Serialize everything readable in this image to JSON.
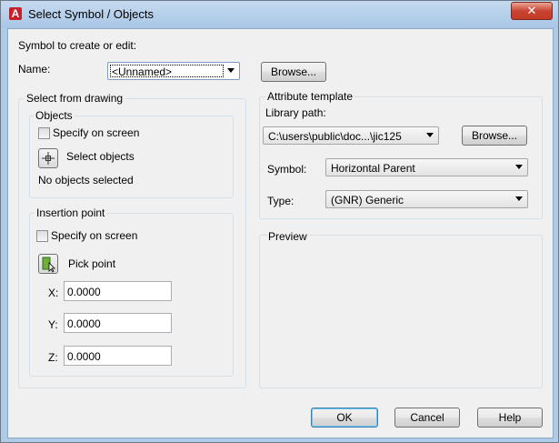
{
  "window": {
    "title": "Select Symbol / Objects",
    "app_icon": "A",
    "close_glyph": "✕"
  },
  "symbol_section": {
    "heading": "Symbol to create or edit:",
    "name_label": "Name:",
    "name_value": "<Unnamed>",
    "browse_label": "Browse..."
  },
  "select_from_drawing": {
    "title": "Select from drawing",
    "objects": {
      "title": "Objects",
      "specify_on_screen": "Specify on screen",
      "select_objects": "Select objects",
      "status": "No objects selected"
    },
    "insertion_point": {
      "title": "Insertion point",
      "specify_on_screen": "Specify on screen",
      "pick_point": "Pick point",
      "x_label": "X:",
      "x_value": "0.0000",
      "y_label": "Y:",
      "y_value": "0.0000",
      "z_label": "Z:",
      "z_value": "0.0000"
    }
  },
  "attribute_template": {
    "title": "Attribute template",
    "library_path_label": "Library path:",
    "library_path_value": "C:\\users\\public\\doc...\\jic125",
    "browse_label": "Browse...",
    "symbol_label": "Symbol:",
    "symbol_value": "Horizontal Parent",
    "type_label": "Type:",
    "type_value": "(GNR) Generic"
  },
  "preview": {
    "title": "Preview"
  },
  "buttons": {
    "ok": "OK",
    "cancel": "Cancel",
    "help": "Help"
  }
}
